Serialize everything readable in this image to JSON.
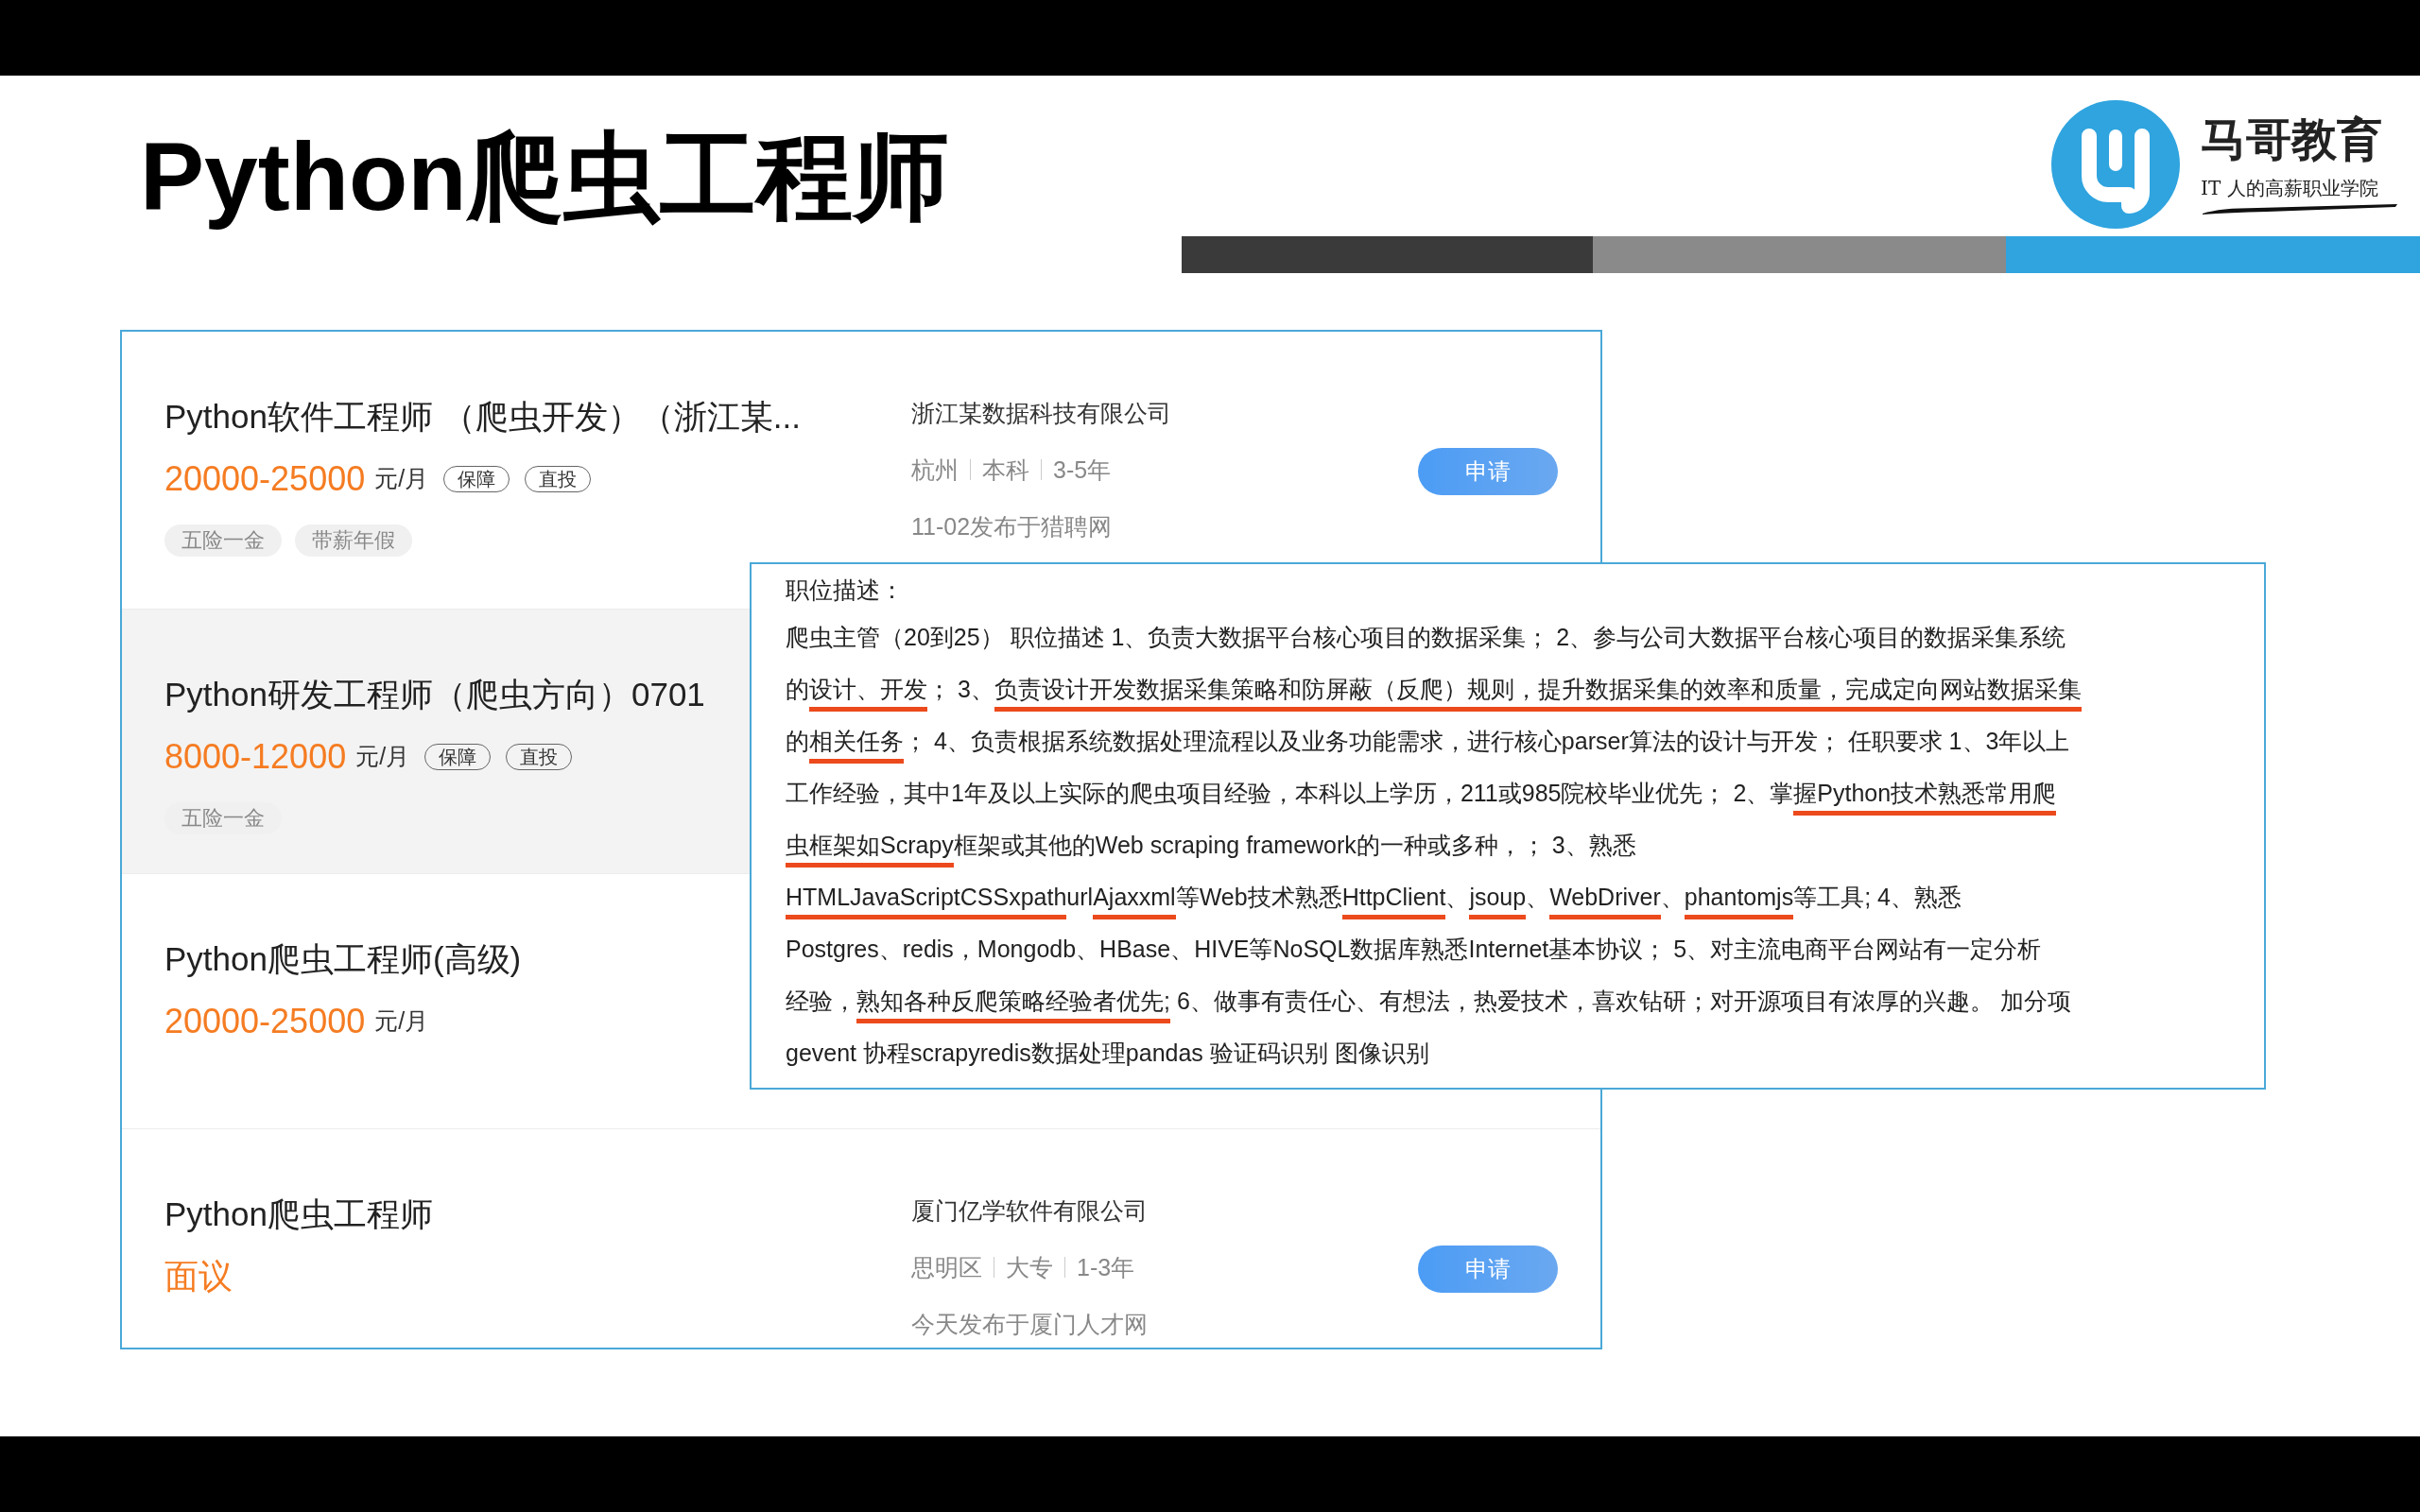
{
  "slide": {
    "title": "Python爬虫工程师"
  },
  "logo": {
    "name": "马哥教育",
    "slogan": "IT 人的高薪职业学院"
  },
  "jobs": [
    {
      "title": "Python软件工程师 （爬虫开发）（浙江某...",
      "salary": "20000-25000",
      "unit": "元/月",
      "badges": [
        "保障",
        "直投"
      ],
      "benefits": [
        "五险一金",
        "带薪年假"
      ],
      "company": "浙江某数据科技有限公司",
      "meta": [
        "杭州",
        "本科",
        "3-5年"
      ],
      "date": "11-02发布于猎聘网",
      "apply": "申请",
      "highlighted": false
    },
    {
      "title": "Python研发工程师（爬虫方向）0701",
      "salary": "8000-12000",
      "unit": "元/月",
      "badges": [
        "保障",
        "直投"
      ],
      "benefits": [
        "五险一金"
      ],
      "highlighted": true
    },
    {
      "title": "Python爬虫工程师(高级)",
      "salary": "20000-25000",
      "unit": "元/月",
      "highlighted": false
    },
    {
      "title": "Python爬虫工程师",
      "salary": "面议",
      "company": "厦门亿学软件有限公司",
      "meta": [
        "思明区",
        "大专",
        "1-3年"
      ],
      "date": "今天发布于厦门人才网",
      "apply": "申请",
      "highlighted": false
    }
  ],
  "description": {
    "heading": "职位描述：",
    "lines": [
      [
        {
          "text": "爬虫主管（20到25） 职位描述 1、负责大数据平台核心项目的数据采集； 2、参与公司大数据平台核心项目的数据采集系统",
          "underlined": false
        }
      ],
      [
        {
          "text": "的",
          "underlined": false
        },
        {
          "text": "设计、开发",
          "underlined": true
        },
        {
          "text": "； 3、",
          "underlined": false
        },
        {
          "text": "负责设计开发数据采集策略和防屏蔽（反爬）规则，提升数据采集的效率和质量，完成定向网站数据采集",
          "underlined": true
        }
      ],
      [
        {
          "text": "的",
          "underlined": false
        },
        {
          "text": "相关任务",
          "underlined": true
        },
        {
          "text": "； 4、负责根据系统数据处理流程以及业务功能需求，进行核心parser算法的设计与开发； 任职要求 1、3年以上",
          "underlined": false
        }
      ],
      [
        {
          "text": "工作经验，其中1年及以上实际的爬虫项目经验，本科以上学历，211或985院校毕业优先； 2、掌",
          "underlined": false
        },
        {
          "text": "握Python技术熟悉常用爬",
          "underlined": true
        }
      ],
      [
        {
          "text": "虫框架如Scrapy",
          "underlined": true
        },
        {
          "text": "框架或其他的Web scraping framework的一种或多种，； 3、熟悉",
          "underlined": false
        }
      ],
      [
        {
          "text": "HTML",
          "underlined": true
        },
        {
          "text": "JavaScript",
          "underlined": true
        },
        {
          "text": "CSS",
          "underlined": true
        },
        {
          "text": "xpath",
          "underlined": true
        },
        {
          "text": "url",
          "underlined": false
        },
        {
          "text": "Ajax",
          "underlined": true
        },
        {
          "text": "xml",
          "underlined": true
        },
        {
          "text": "等Web技术熟悉",
          "underlined": false
        },
        {
          "text": "HttpClient",
          "underlined": true
        },
        {
          "text": "、",
          "underlined": false
        },
        {
          "text": "jsoup",
          "underlined": true
        },
        {
          "text": "、",
          "underlined": false
        },
        {
          "text": "WebDriver",
          "underlined": true
        },
        {
          "text": "、",
          "underlined": false
        },
        {
          "text": "phantomjs",
          "underlined": true
        },
        {
          "text": "等工具; 4、熟悉",
          "underlined": false
        }
      ],
      [
        {
          "text": "Postgres、redis，Mongodb、HBase、HIVE等NoSQL数据库熟悉Internet基本协议； 5、对主流电商平台网站有一定分析",
          "underlined": false
        }
      ],
      [
        {
          "text": "经验，",
          "underlined": false
        },
        {
          "text": "熟知各种反爬策略经验者优先;",
          "underlined": true
        },
        {
          "text": " 6、做事有责任心、有想法，热爱技术，喜欢钻研；对开源项目有浓厚的兴趣。 加分项",
          "underlined": false
        }
      ],
      [
        {
          "text": "gevent 协程scrapyredis数据处理pandas 验证码识别 图像识别",
          "underlined": false
        }
      ]
    ]
  }
}
